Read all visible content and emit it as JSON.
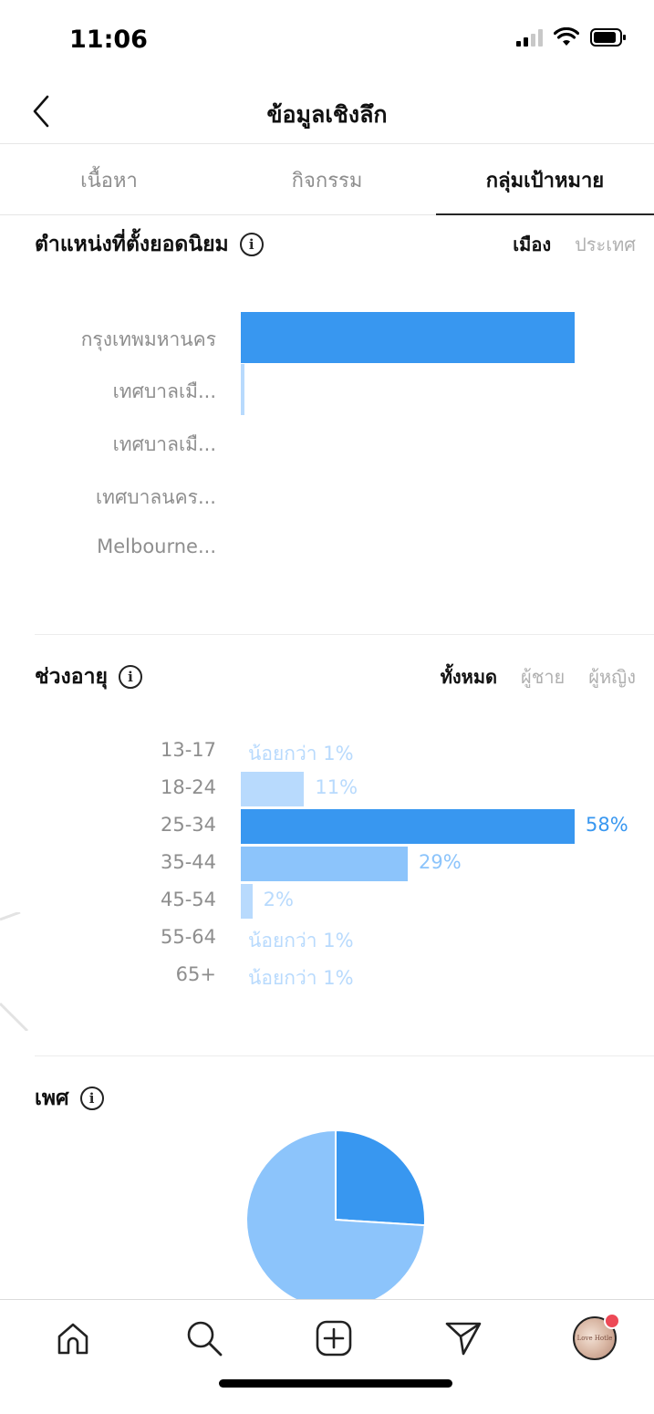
{
  "status": {
    "time": "11:06"
  },
  "header": {
    "title": "ข้อมูลเชิงลึก"
  },
  "tabs": [
    {
      "label": "เนื้อหา",
      "active": false
    },
    {
      "label": "กิจกรรม",
      "active": false
    },
    {
      "label": "กลุ่มเป้าหมาย",
      "active": true
    }
  ],
  "locations": {
    "title": "ตำแหน่งที่ตั้งยอดนิยม",
    "filters": [
      {
        "label": "เมือง",
        "active": true
      },
      {
        "label": "ประเทศ",
        "active": false
      }
    ],
    "items": [
      {
        "label": "กรุงเทพมหานคร",
        "share": 1.0
      },
      {
        "label": "เทศบาลเมื...",
        "share": 0.012
      },
      {
        "label": "เทศบาลเมื...",
        "share": 0
      },
      {
        "label": "เทศบาลนคร...",
        "share": 0
      },
      {
        "label": "Melbourne...",
        "share": 0
      }
    ]
  },
  "age": {
    "title": "ช่วงอายุ",
    "filters": [
      {
        "label": "ทั้งหมด",
        "active": true
      },
      {
        "label": "ผู้ชาย",
        "active": false
      },
      {
        "label": "ผู้หญิง",
        "active": false
      }
    ],
    "items": [
      {
        "range": "13-17",
        "percent": 0,
        "label": "น้อยกว่า 1%"
      },
      {
        "range": "18-24",
        "percent": 11,
        "label": "11%"
      },
      {
        "range": "25-34",
        "percent": 58,
        "label": "58%"
      },
      {
        "range": "35-44",
        "percent": 29,
        "label": "29%"
      },
      {
        "range": "45-54",
        "percent": 2,
        "label": "2%"
      },
      {
        "range": "55-64",
        "percent": 0,
        "label": "น้อยกว่า 1%"
      },
      {
        "range": "65+",
        "percent": 0,
        "label": "น้อยกว่า 1%"
      }
    ]
  },
  "gender": {
    "title": "เพศ",
    "slices": [
      {
        "value": 26,
        "color": "#3897f0"
      },
      {
        "value": 74,
        "color": "#8cc4fb"
      }
    ]
  },
  "colors": {
    "primary": "#3897f0",
    "medium": "#8cc4fb",
    "light": "#b8dafd",
    "label": "#8e8e8e"
  },
  "nav": [
    "home-icon",
    "search-icon",
    "new-post-icon",
    "direct-icon",
    "profile-avatar"
  ],
  "avatar_text": "Love Hotle"
}
